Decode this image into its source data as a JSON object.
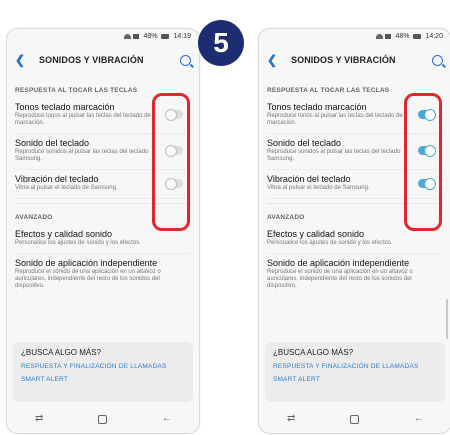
{
  "step_badge": "5",
  "colors": {
    "badge_bg": "#1d2d72",
    "highlight": "#e3262c",
    "toggle_on": "#4aa9d7",
    "link": "#2a7bd1",
    "accent": "#2a6fd6"
  },
  "left": {
    "status": {
      "battery": "48%",
      "time": "14:19"
    },
    "appbar": {
      "title": "SONIDOS Y VIBRACIÓN"
    },
    "section1": "RESPUESTA AL TOCAR LAS TECLAS",
    "settings": [
      {
        "title": "Tonos teclado marcación",
        "desc": "Reproduce tonos al pulsar las teclas del teclado de marcación.",
        "on": false
      },
      {
        "title": "Sonido del teclado",
        "desc": "Reproduce sonidos al pulsar las teclas del teclado Samsung.",
        "on": false
      },
      {
        "title": "Vibración del teclado",
        "desc": "Vibra al pulsar el teclado de Samsung.",
        "on": false
      }
    ],
    "section2": "AVANZADO",
    "advanced": [
      {
        "title": "Efectos y calidad sonido",
        "desc": "Personalice los ajustes de sonido y los efectos."
      },
      {
        "title": "Sonido de aplicación independiente",
        "desc": "Reproduce el sonido de una aplicación en un altavoz o auriculares, independiente del resto de los sonidos del dispositivo."
      }
    ],
    "card": {
      "title": "¿BUSCA ALGO MÁS?",
      "links": [
        "RESPUESTA Y FINALIZACIÓN DE LLAMADAS",
        "SMART ALERT"
      ]
    }
  },
  "right": {
    "status": {
      "battery": "48%",
      "time": "14:20"
    },
    "appbar": {
      "title": "SONIDOS Y VIBRACIÓN"
    },
    "section1": "RESPUESTA AL TOCAR LAS TECLAS",
    "settings": [
      {
        "title": "Tonos teclado marcación",
        "desc": "Reproduce tonos al pulsar las teclas del teclado de marcación.",
        "on": true
      },
      {
        "title": "Sonido del teclado",
        "desc": "Reproduce sonidos al pulsar las teclas del teclado Samsung.",
        "on": true
      },
      {
        "title": "Vibración del teclado",
        "desc": "Vibra al pulsar el teclado de Samsung.",
        "on": true
      }
    ],
    "section2": "AVANZADO",
    "advanced": [
      {
        "title": "Efectos y calidad sonido",
        "desc": "Personalice los ajustes de sonido y los efectos."
      },
      {
        "title": "Sonido de aplicación independiente",
        "desc": "Reproduce el sonido de una aplicación en un altavoz o auriculares, independiente del resto de los sonidos del dispositivo."
      }
    ],
    "card": {
      "title": "¿BUSCA ALGO MÁS?",
      "links": [
        "RESPUESTA Y FINALIZACIÓN DE LLAMADAS",
        "SMART ALERT"
      ]
    }
  }
}
